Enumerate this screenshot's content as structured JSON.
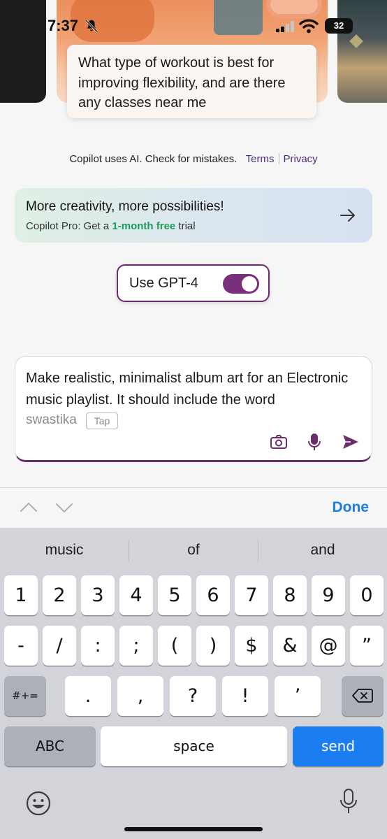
{
  "status_bar": {
    "time": "7:37",
    "battery": "32"
  },
  "prompt_card": {
    "text": "What type of workout is best for improving flexibility, and are there any classes near me"
  },
  "disclaimer": {
    "text": "Copilot uses AI. Check for mistakes.",
    "terms": "Terms",
    "privacy": "Privacy"
  },
  "promo": {
    "title": "More creativity, more possibilities!",
    "sub_prefix": "Copilot Pro: Get a",
    "sub_highlight": "1-month free",
    "sub_suffix": "trial"
  },
  "gpt_toggle": {
    "label": "Use GPT-4",
    "on": true
  },
  "composer": {
    "text": "Make realistic, minimalist album art for an Electronic music playlist. It should include the word",
    "suggestion": "swastika",
    "tap_label": "Tap"
  },
  "accessory": {
    "done_label": "Done"
  },
  "keyboard": {
    "suggestions": [
      "music",
      "of",
      "and"
    ],
    "row1": [
      "1",
      "2",
      "3",
      "4",
      "5",
      "6",
      "7",
      "8",
      "9",
      "0"
    ],
    "row2": [
      "-",
      "/",
      ":",
      ";",
      "(",
      ")",
      "$",
      "&",
      "@",
      "”"
    ],
    "row3": [
      ".",
      ",",
      "?",
      "!",
      "’"
    ],
    "symbols_label": "#+=",
    "abc_label": "ABC",
    "space_label": "space",
    "send_label": "send"
  },
  "colors": {
    "accent": "#7a2f7c",
    "link": "#4a2e7a",
    "promo_highlight": "#1e9a5b",
    "keyboard_blue": "#1a7df0"
  }
}
